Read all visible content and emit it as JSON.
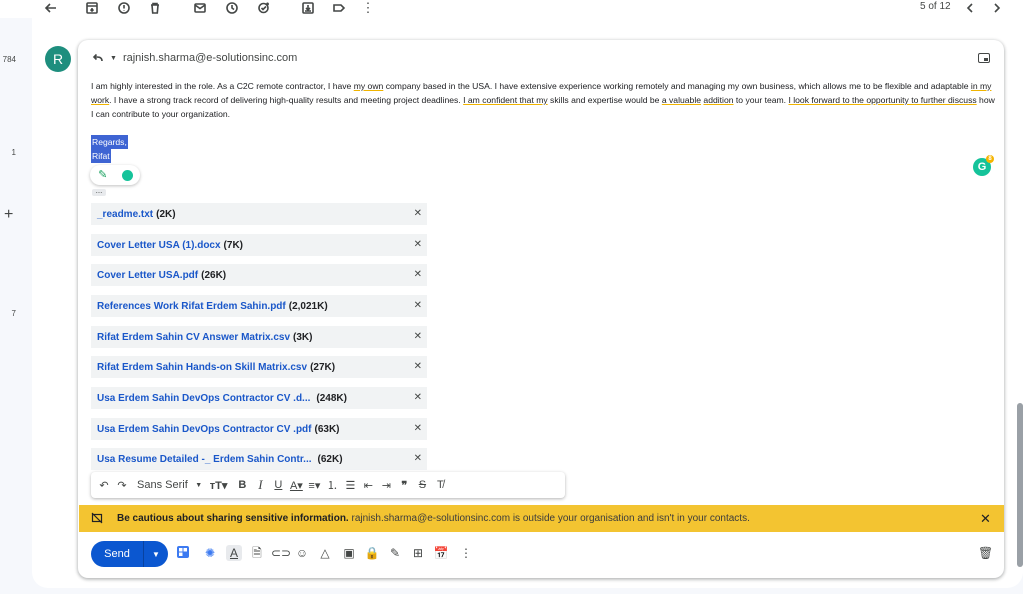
{
  "pager": {
    "text": "5 of 12"
  },
  "left_numbers": [
    "784",
    "1",
    "7"
  ],
  "sender": {
    "avatar_letter": "R",
    "email": "rajnish.sharma@e-solutionsinc.com"
  },
  "body": {
    "p1": "I am highly interested in the role. As a C2C remote contractor, I have ",
    "u1": "my own",
    "p2": " company based in the USA. I have extensive experience working remotely and managing my own business, which allows me to be flexible and adaptable ",
    "u2": "in my work",
    "p3": ". I have a strong track record of delivering high-quality results and meeting project deadlines. ",
    "u3": "I am confident that my",
    "p4": " skills and expertise would be ",
    "u4": "a valuable",
    "p5": " ",
    "u5": "addition",
    "p6": " to your team. ",
    "u6": "I look forward to the opportunity to further discuss",
    "p7": " how I can contribute to your organization."
  },
  "signature": {
    "line1": "Regards,",
    "line2": "Rifat"
  },
  "grammarly": {
    "badge_count": "8",
    "letter": "G"
  },
  "attachments": [
    {
      "name": "_readme.txt",
      "size": "(2K)"
    },
    {
      "name": "Cover Letter USA (1).docx",
      "size": "(7K)"
    },
    {
      "name": "Cover Letter USA.pdf",
      "size": "(26K)"
    },
    {
      "name": "References Work Rifat Erdem Sahin.pdf",
      "size": "(2,021K)"
    },
    {
      "name": "Rifat Erdem Sahin CV Answer Matrix.csv",
      "size": "(3K)"
    },
    {
      "name": "Rifat Erdem Sahin Hands-on Skill Matrix.csv",
      "size": "(27K)"
    },
    {
      "name": "Usa Erdem Sahin DevOps Contractor CV .d...",
      "size": "(248K)"
    },
    {
      "name": "Usa Erdem Sahin DevOps Contractor CV .pdf",
      "size": "(63K)"
    },
    {
      "name": "Usa Resume Detailed -_ Erdem Sahin Contr...",
      "size": "(62K)"
    }
  ],
  "format_bar": {
    "font": "Sans Serif"
  },
  "warning": {
    "bold": "Be cautious about sharing sensitive information.",
    "rest": " rajnish.sharma@e-solutionsinc.com is outside your organisation and isn't in your contacts."
  },
  "compose": {
    "send_label": "Send"
  },
  "colors": {
    "send": "#0b57d0",
    "warning_bg": "#f3c431",
    "selection": "#3e64d3",
    "link": "#1a57c9"
  }
}
